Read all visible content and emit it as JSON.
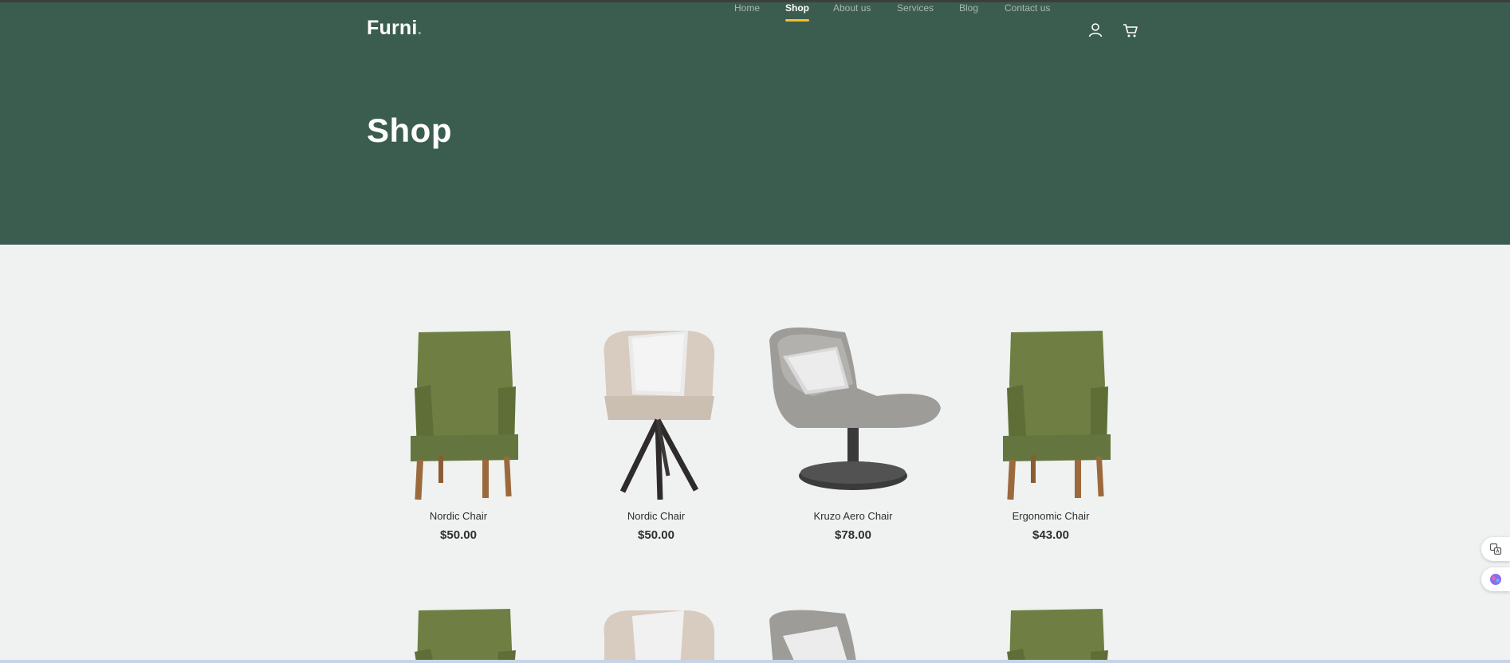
{
  "brand": {
    "name": "Furni",
    "dot": "."
  },
  "nav": {
    "items": [
      {
        "label": "Home",
        "active": false
      },
      {
        "label": "Shop",
        "active": true
      },
      {
        "label": "About us",
        "active": false
      },
      {
        "label": "Services",
        "active": false
      },
      {
        "label": "Blog",
        "active": false
      },
      {
        "label": "Contact us",
        "active": false
      }
    ],
    "icons": [
      "user-icon",
      "cart-icon"
    ]
  },
  "hero": {
    "title": "Shop"
  },
  "products": [
    {
      "name": "Nordic Chair",
      "price": "$50.00",
      "image": "green-chair"
    },
    {
      "name": "Nordic Chair",
      "price": "$50.00",
      "image": "beige-swivel-chair"
    },
    {
      "name": "Kruzo Aero Chair",
      "price": "$78.00",
      "image": "grey-lounge-chair"
    },
    {
      "name": "Ergonomic Chair",
      "price": "$43.00",
      "image": "green-chair"
    }
  ],
  "colors": {
    "hero": "#3b5d50",
    "accent": "#f9bf29",
    "background": "#eff2f1"
  }
}
